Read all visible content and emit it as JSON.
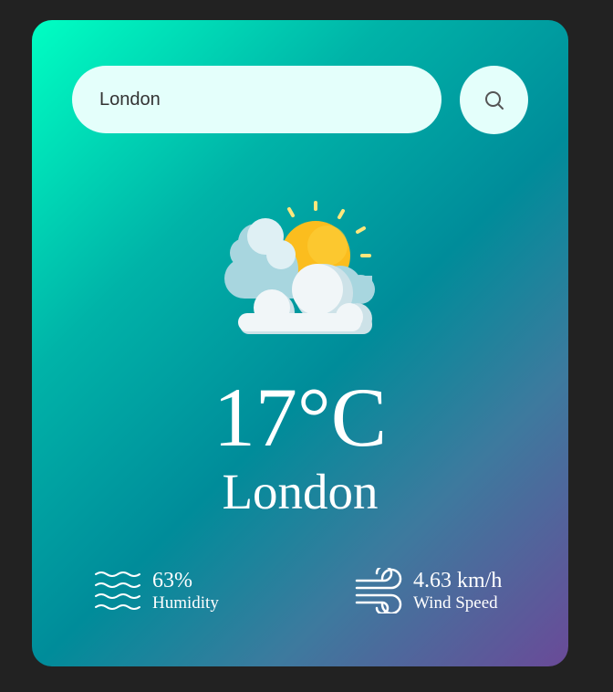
{
  "search": {
    "value": "London",
    "icon": "search-icon"
  },
  "weather": {
    "icon": "partly-cloudy-icon",
    "temperature": "17°C",
    "city": "London"
  },
  "details": {
    "humidity": {
      "value": "63%",
      "label": "Humidity",
      "icon": "humidity-waves-icon"
    },
    "wind": {
      "value": "4.63 km/h",
      "label": "Wind Speed",
      "icon": "wind-icon"
    }
  },
  "colors": {
    "gradient_start": "#00ffc3",
    "gradient_mid": "#008c9a",
    "gradient_end": "#6a4a98",
    "input_bg": "#e4fffb"
  }
}
